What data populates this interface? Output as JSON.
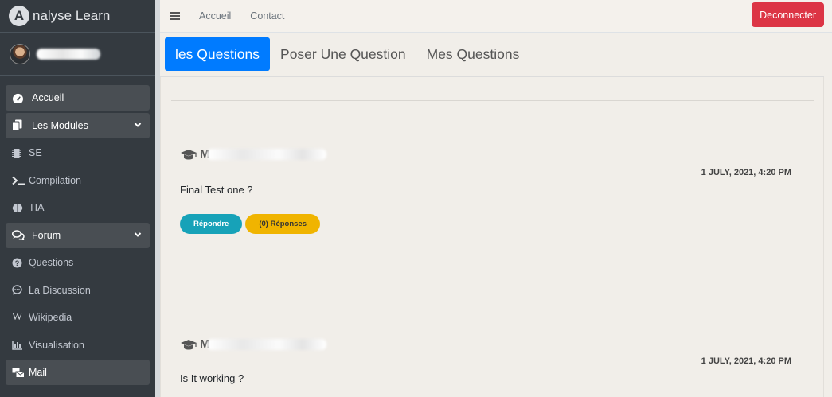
{
  "brand": {
    "logo_letter": "A",
    "name": "nalyse Learn"
  },
  "sidebar": {
    "items": [
      {
        "label": "Accueil",
        "icon": "dashboard-icon"
      },
      {
        "label": "Les Modules",
        "icon": "copy-icon"
      },
      {
        "label": "SE",
        "icon": "chip-icon"
      },
      {
        "label": "Compilation",
        "icon": "terminal-icon"
      },
      {
        "label": "TIA",
        "icon": "brain-icon"
      },
      {
        "label": "Forum",
        "icon": "comments-icon"
      },
      {
        "label": "Questions",
        "icon": "question-circle-icon"
      },
      {
        "label": "La Discussion",
        "icon": "comment-dots-icon"
      },
      {
        "label": "Wikipedia",
        "icon": "wikipedia-icon"
      },
      {
        "label": "Visualisation",
        "icon": "chart-bar-icon"
      },
      {
        "label": "Mail",
        "icon": "mail-bulk-icon"
      }
    ]
  },
  "topbar": {
    "links": [
      "Accueil",
      "Contact"
    ],
    "logout_label": "Deconnecter"
  },
  "tabs": [
    "les Questions",
    "Poser Une Question",
    "Mes Questions"
  ],
  "questions": [
    {
      "author_initial": "M",
      "date": "1 JULY, 2021, 4:20 PM",
      "text": "Final Test one ?",
      "reply_label": "Répondre",
      "responses_label": "(0) Réponses"
    },
    {
      "author_initial": "M",
      "date": "1 JULY, 2021, 4:20 PM",
      "text": "Is It working ?"
    }
  ],
  "colors": {
    "sidebar_bg": "#343a40",
    "primary": "#007bff",
    "danger": "#dc3545",
    "info": "#17a2b8",
    "warning": "#f0b400"
  }
}
